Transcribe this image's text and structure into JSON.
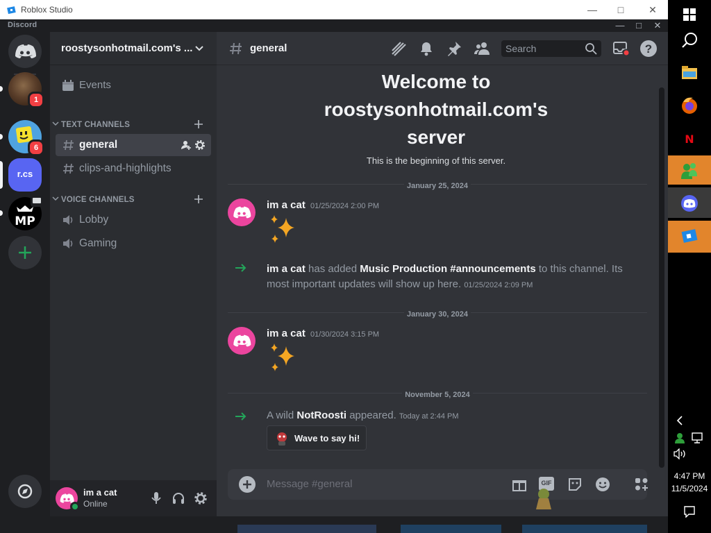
{
  "roblox": {
    "title": "Roblox Studio"
  },
  "discord": {
    "wordmark": "Discord"
  },
  "servers": [
    {
      "badge": "1"
    },
    {
      "badge": "6"
    },
    {
      "label": "r.cs"
    }
  ],
  "guild": {
    "name": "roostysonhotmail.com's ...",
    "events_label": "Events",
    "text_category": "TEXT CHANNELS",
    "voice_category": "VOICE CHANNELS",
    "text_channels": [
      "general",
      "clips-and-highlights"
    ],
    "voice_channels": [
      "Lobby",
      "Gaming"
    ]
  },
  "user": {
    "name": "im a cat",
    "status": "Online"
  },
  "chat": {
    "channel": "general",
    "search_placeholder": "Search",
    "welcome_line1": "Welcome to",
    "welcome_line2": "roostysonhotmail.com's",
    "welcome_line3": "server",
    "welcome_sub": "This is the beginning of this server.",
    "date1": "January 25, 2024",
    "msg1": {
      "author": "im a cat",
      "time": "01/25/2024 2:00 PM"
    },
    "sys1": {
      "author": "im a cat",
      "pre": "has added",
      "target": "Music Production #announcements",
      "post": "to this channel. Its most important updates will show up here.",
      "time": "01/25/2024 2:09 PM"
    },
    "date2": "January 30, 2024",
    "msg2": {
      "author": "im a cat",
      "time": "01/30/2024 3:15 PM"
    },
    "date3": "November 5, 2024",
    "sys2": {
      "pre": "A wild",
      "name": "NotRoosti",
      "post": "appeared.",
      "time": "Today at 2:44 PM"
    },
    "wave_label": "Wave to say hi!",
    "input_placeholder": "Message #general"
  },
  "taskbar": {
    "time": "4:47 PM",
    "date": "11/5/2024"
  },
  "colors": {
    "blurple": "#5865f2",
    "pink": "#eb459e",
    "green": "#23a55a",
    "red": "#f23f43"
  }
}
